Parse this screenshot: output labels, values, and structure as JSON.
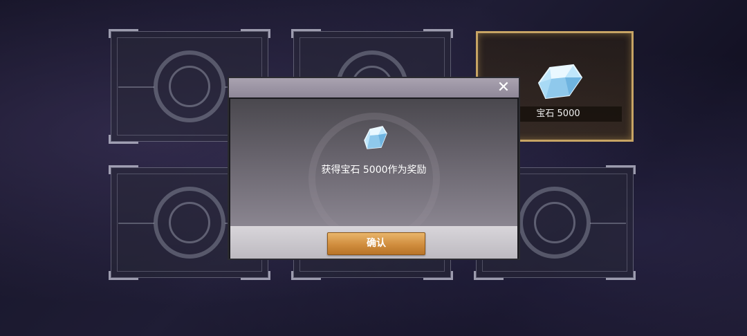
{
  "cards": [
    {
      "id": "card-1",
      "state": "hidden"
    },
    {
      "id": "card-2",
      "state": "hidden"
    },
    {
      "id": "card-3",
      "state": "revealed",
      "reward": {
        "icon": "gem-icon",
        "label": "宝石  5000"
      }
    },
    {
      "id": "card-4",
      "state": "hidden"
    },
    {
      "id": "card-5",
      "state": "hidden"
    },
    {
      "id": "card-6",
      "state": "hidden"
    }
  ],
  "modal": {
    "close_icon": "close-icon",
    "close_glyph": "✕",
    "reward_icon": "gem-icon",
    "message": "获得宝石  5000作为奖励",
    "confirm_label": "确认"
  },
  "colors": {
    "accent_gold": "#c7a464",
    "button_orange": "#d08d3e",
    "gem_blue": "#a9d8f2"
  }
}
